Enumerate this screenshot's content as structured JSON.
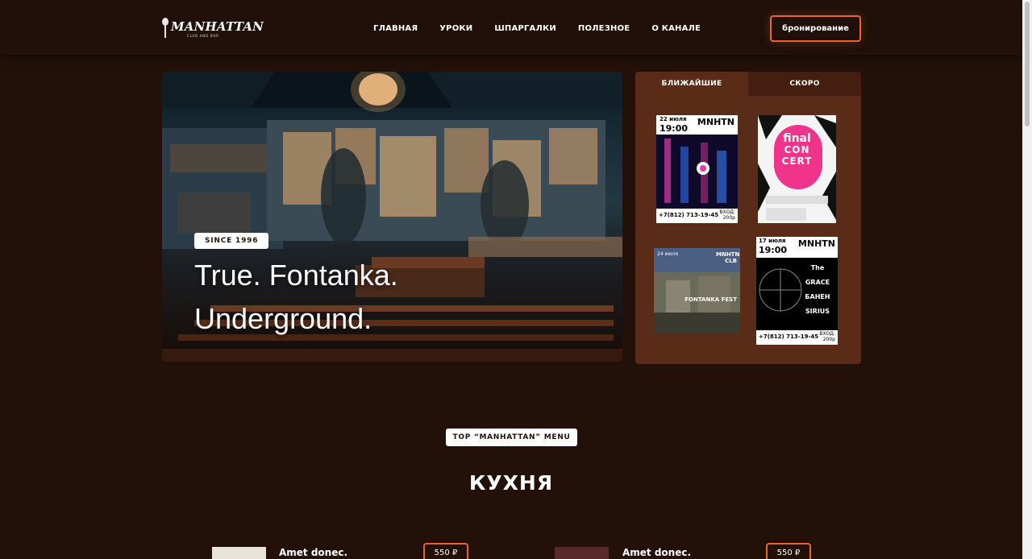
{
  "header": {
    "logo_text": "MANHATTAN",
    "logo_sub": "CLUB AND BAR",
    "nav": [
      "ГЛАВНАЯ",
      "УРОКИ",
      "ШПАРГАЛКИ",
      "ПОЛЕЗНОЕ",
      "О КАНАЛЕ"
    ],
    "book_label": "бронирование"
  },
  "hero": {
    "badge": "SINCE 1996",
    "line1": "True. Fontanka.",
    "line2": "Underground."
  },
  "events": {
    "tabs": [
      "БЛИЖАЙШИЕ",
      "СКОРО"
    ],
    "posters": [
      {
        "date": "22 июля",
        "time": "19:00",
        "brand": "MNHTN",
        "phone": "+7(812) 713-19-45",
        "entry": "ВХОД: 200р"
      },
      {
        "line1": "final",
        "line2": "CON",
        "line3": "CERT"
      },
      {
        "date": "24 июля",
        "brand": "MNHTN CLB",
        "title": "FONTANKA FEST"
      },
      {
        "date": "17 июля",
        "time": "19:00",
        "brand": "MNHTN",
        "acts": [
          "The GRACE",
          "БАНЕН",
          "SIRIUS"
        ],
        "phone": "+7(812) 713-19-45",
        "entry": "ВХОД: 200р"
      }
    ]
  },
  "menu": {
    "badge": "TOP “MANHATTAN” MENU",
    "heading": "КУХНЯ",
    "items": [
      {
        "name": "Amet donec.",
        "price": "550 ₽"
      },
      {
        "name": "Amet donec.",
        "price": "550 ₽"
      }
    ]
  },
  "colors": {
    "background": "#231109",
    "accent": "#e8662b",
    "panel": "#5a2c17"
  }
}
